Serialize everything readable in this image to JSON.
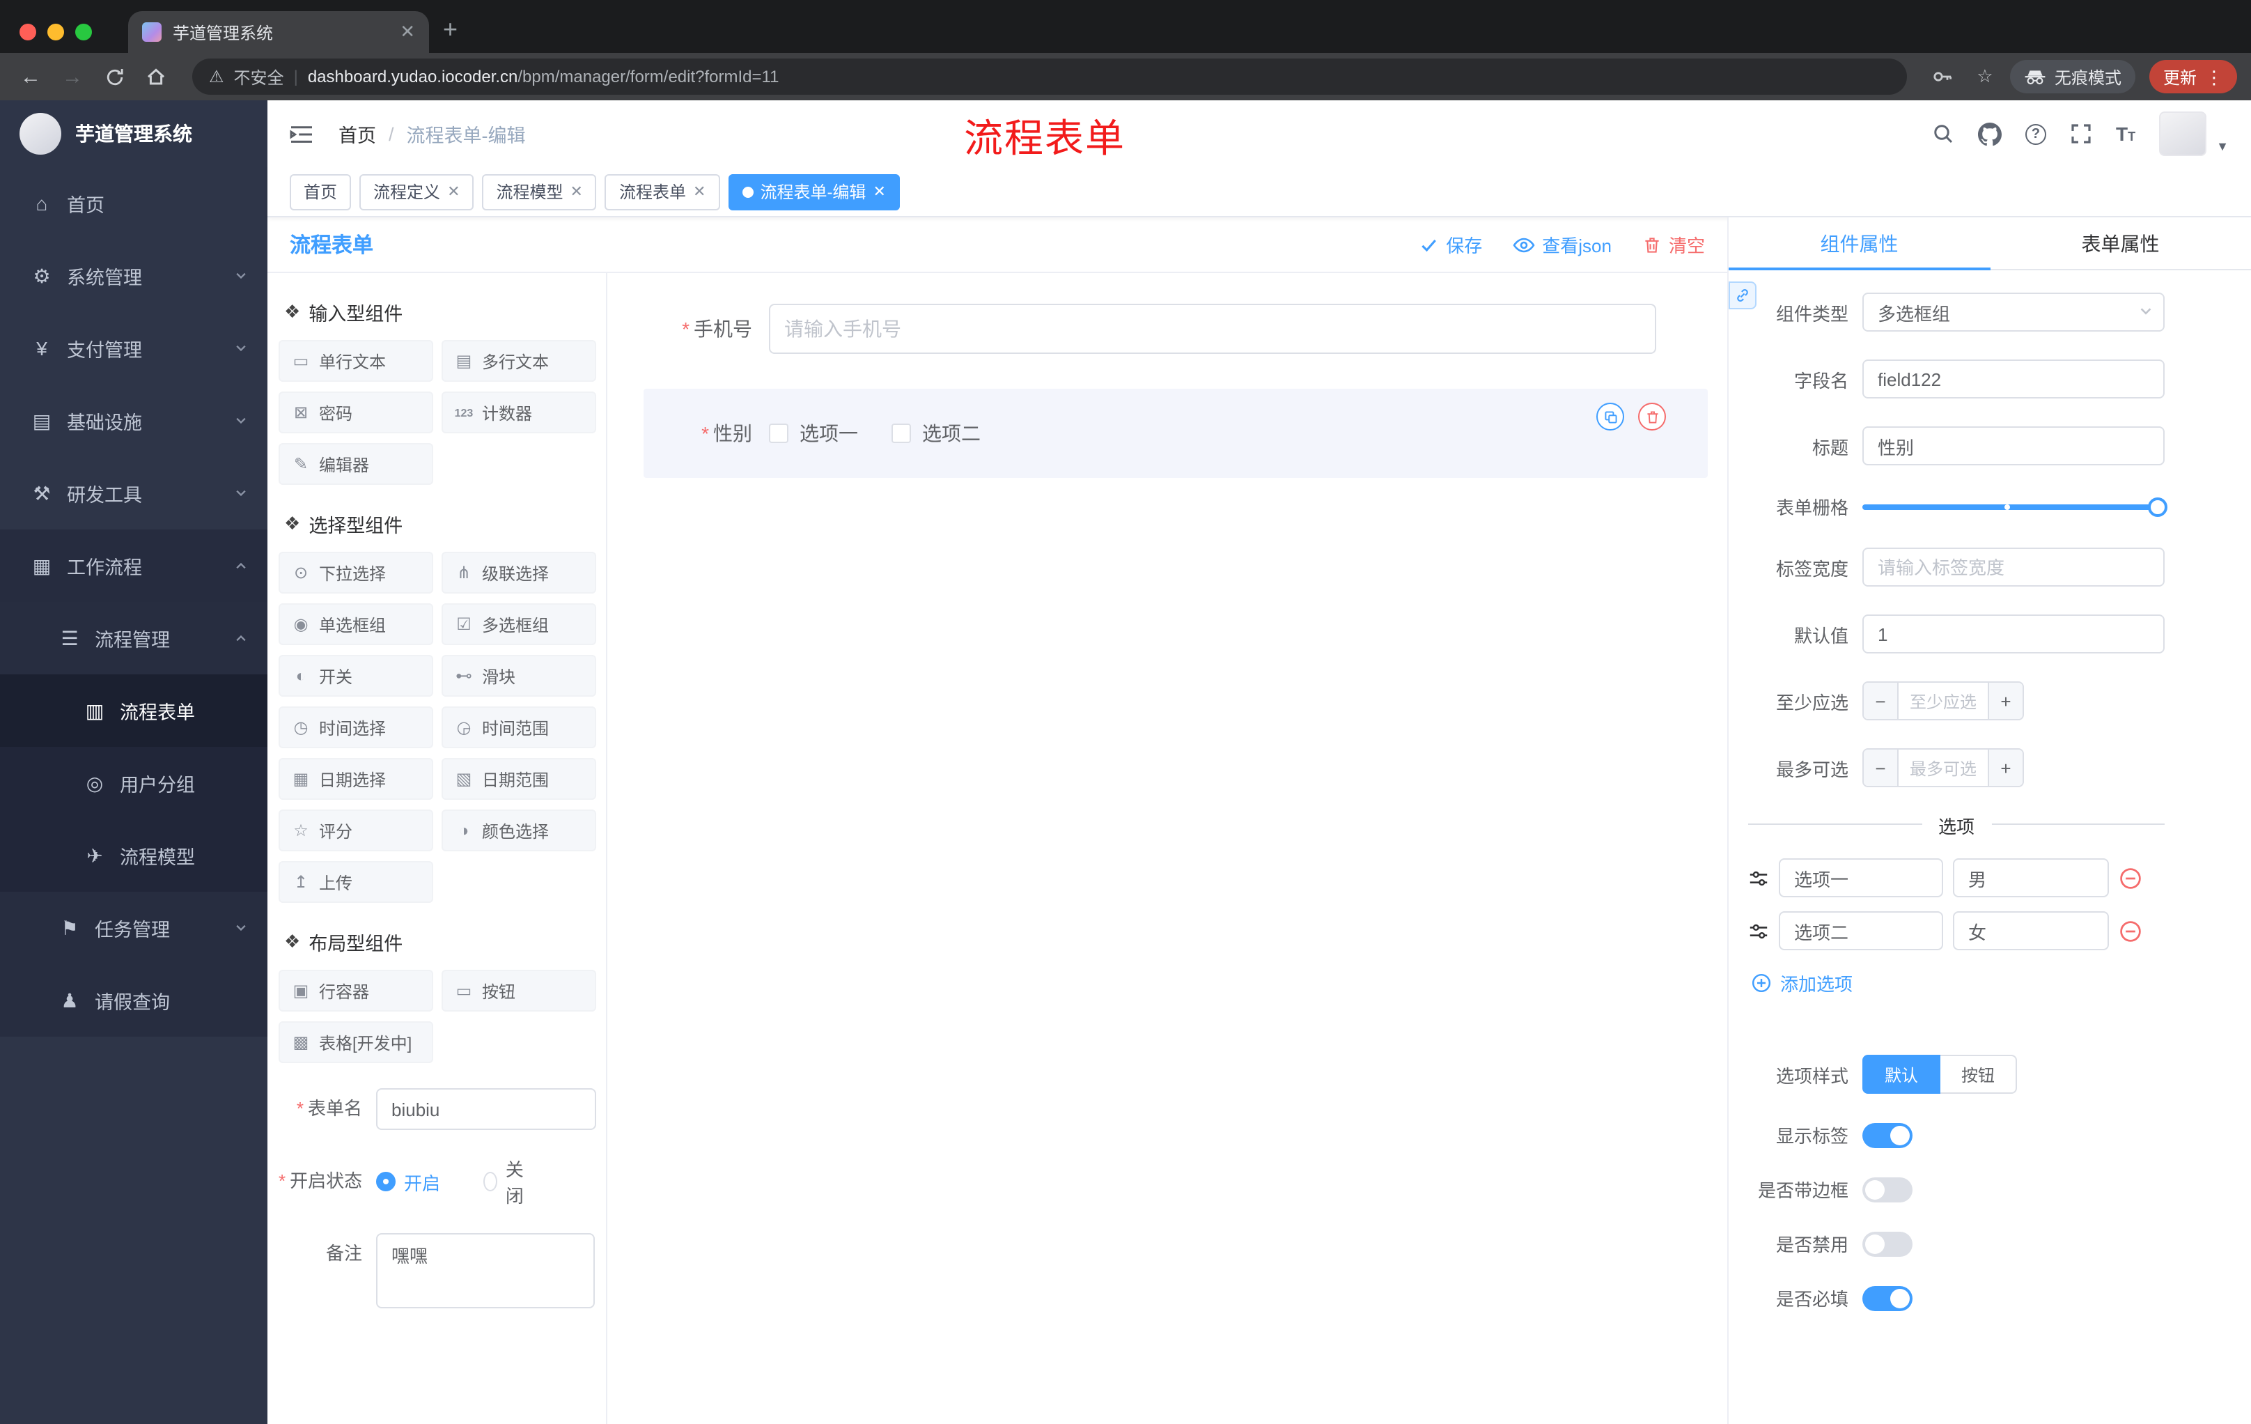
{
  "browser": {
    "tab_title": "芋道管理系统",
    "not_secure_label": "不安全",
    "url_domain": "dashboard.yudao.iocoder.cn",
    "url_path": "/bpm/manager/form/edit?formId=11",
    "incognito_label": "无痕模式",
    "update_label": "更新"
  },
  "sidebar": {
    "logo_title": "芋道管理系统",
    "items": [
      {
        "label": "首页"
      },
      {
        "label": "系统管理"
      },
      {
        "label": "支付管理"
      },
      {
        "label": "基础设施"
      },
      {
        "label": "研发工具"
      },
      {
        "label": "工作流程"
      },
      {
        "label": "流程管理"
      },
      {
        "label": "流程表单"
      },
      {
        "label": "用户分组"
      },
      {
        "label": "流程模型"
      },
      {
        "label": "任务管理"
      },
      {
        "label": "请假查询"
      }
    ]
  },
  "header": {
    "breadcrumb_home": "首页",
    "breadcrumb_current": "流程表单-编辑",
    "overlay_annotation": "流程表单"
  },
  "tags": {
    "items": [
      {
        "label": "首页"
      },
      {
        "label": "流程定义"
      },
      {
        "label": "流程模型"
      },
      {
        "label": "流程表单"
      },
      {
        "label": "流程表单-编辑"
      }
    ]
  },
  "builder": {
    "title": "流程表单",
    "save_label": "保存",
    "view_json_label": "查看json",
    "clear_label": "清空"
  },
  "palette": {
    "sections": [
      {
        "title": "输入型组件",
        "items": [
          "单行文本",
          "多行文本",
          "密码",
          "计数器",
          "编辑器"
        ]
      },
      {
        "title": "选择型组件",
        "items": [
          "下拉选择",
          "级联选择",
          "单选框组",
          "多选框组",
          "开关",
          "滑块",
          "时间选择",
          "时间范围",
          "日期选择",
          "日期范围",
          "评分",
          "颜色选择",
          "上传"
        ]
      },
      {
        "title": "布局型组件",
        "items": [
          "行容器",
          "按钮",
          "表格[开发中]"
        ]
      }
    ],
    "form": {
      "name_label": "表单名",
      "name_value": "biubiu",
      "status_label": "开启状态",
      "status_on": "开启",
      "status_off": "关闭",
      "remark_label": "备注",
      "remark_value": "嘿嘿"
    }
  },
  "canvas": {
    "phone": {
      "label": "手机号",
      "placeholder": "请输入手机号"
    },
    "gender": {
      "label": "性别",
      "option1": "选项一",
      "option2": "选项二"
    }
  },
  "props": {
    "tab_component": "组件属性",
    "tab_form": "表单属性",
    "component_type_label": "组件类型",
    "component_type_value": "多选框组",
    "field_name_label": "字段名",
    "field_name_value": "field122",
    "title_label": "标题",
    "title_value": "性别",
    "grid_label": "表单栅格",
    "label_width_label": "标签宽度",
    "label_width_placeholder": "请输入标签宽度",
    "default_label": "默认值",
    "default_value": "1",
    "min_label": "至少应选",
    "min_placeholder": "至少应选",
    "max_label": "最多可选",
    "max_placeholder": "最多可选",
    "options_divider": "选项",
    "options": [
      {
        "label": "选项一",
        "value": "男"
      },
      {
        "label": "选项二",
        "value": "女"
      }
    ],
    "add_option_label": "添加选项",
    "option_style_label": "选项样式",
    "style_default": "默认",
    "style_button": "按钮",
    "show_label": "显示标签",
    "border_label": "是否带边框",
    "disabled_label": "是否禁用",
    "required_label": "是否必填"
  },
  "colors": {
    "primary": "#409EFF",
    "danger": "#F56C6C",
    "annotation_red": "#F21B1B",
    "sidebar_bg": "#2E3548",
    "active_tag_bg": "#409EFF",
    "update_badge_bg": "#C24438"
  }
}
